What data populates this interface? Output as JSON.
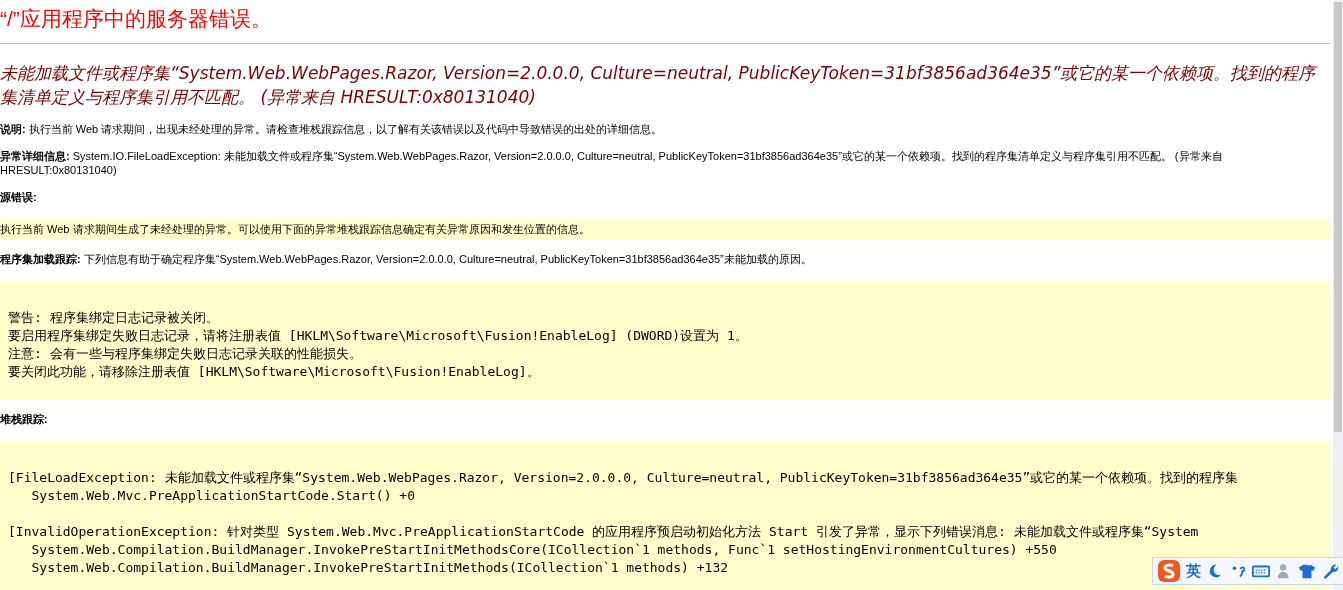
{
  "title": "“/”应用程序中的服务器错误。",
  "error_heading": "未能加载文件或程序集“System.Web.WebPages.Razor, Version=2.0.0.0, Culture=neutral, PublicKeyToken=31bf3856ad364e35”或它的某一个依赖项。找到的程序集清单定义与程序集引用不匹配。 (异常来自 HRESULT:0x80131040)",
  "sections": [
    {
      "kind": "text",
      "label": "说明:",
      "text": "执行当前 Web 请求期间，出现未经处理的异常。请检查堆栈跟踪信息，以了解有关该错误以及代码中导致错误的出处的详细信息。"
    },
    {
      "kind": "text",
      "label": "异常详细信息:",
      "text": "System.IO.FileLoadException: 未能加载文件或程序集“System.Web.WebPages.Razor, Version=2.0.0.0, Culture=neutral, PublicKeyToken=31bf3856ad364e35”或它的某一个依赖项。找到的程序集清单定义与程序集引用不匹配。 (异常来自 HRESULT:0x80131040)"
    },
    {
      "kind": "note",
      "label": "源错误:",
      "note": "执行当前 Web 请求期间生成了未经处理的异常。可以使用下面的异常堆栈跟踪信息确定有关异常原因和发生位置的信息。"
    },
    {
      "kind": "code",
      "label": "程序集加载跟踪:",
      "text": "下列信息有助于确定程序集“System.Web.WebPages.Razor, Version=2.0.0.0, Culture=neutral, PublicKeyToken=31bf3856ad364e35”未能加载的原因。",
      "groups": [
        [
          "警告: 程序集绑定日志记录被关闭。",
          "要启用程序集绑定失败日志记录，请将注册表值 [HKLM\\Software\\Microsoft\\Fusion!EnableLog] (DWORD)设置为 1。",
          "注意: 会有一些与程序集绑定失败日志记录关联的性能损失。",
          "要关闭此功能，请移除注册表值 [HKLM\\Software\\Microsoft\\Fusion!EnableLog]。"
        ]
      ]
    },
    {
      "kind": "code",
      "label": "堆栈跟踪:",
      "groups": [
        [
          "[FileLoadException: 未能加载文件或程序集“System.Web.WebPages.Razor, Version=2.0.0.0, Culture=neutral, PublicKeyToken=31bf3856ad364e35”或它的某一个依赖项。找到的程序集",
          "   System.Web.Mvc.PreApplicationStartCode.Start() +0"
        ],
        [
          "[InvalidOperationException: 针对类型 System.Web.Mvc.PreApplicationStartCode 的应用程序预启动初始化方法 Start 引发了异常，显示下列错误消息: 未能加载文件或程序集“System",
          "   System.Web.Compilation.BuildManager.InvokePreStartInitMethodsCore(ICollection`1 methods, Func`1 setHostingEnvironmentCultures) +550",
          "   System.Web.Compilation.BuildManager.InvokePreStartInitMethods(ICollection`1 methods) +132"
        ]
      ]
    }
  ],
  "ime_toolbar": {
    "mode": "英"
  }
}
